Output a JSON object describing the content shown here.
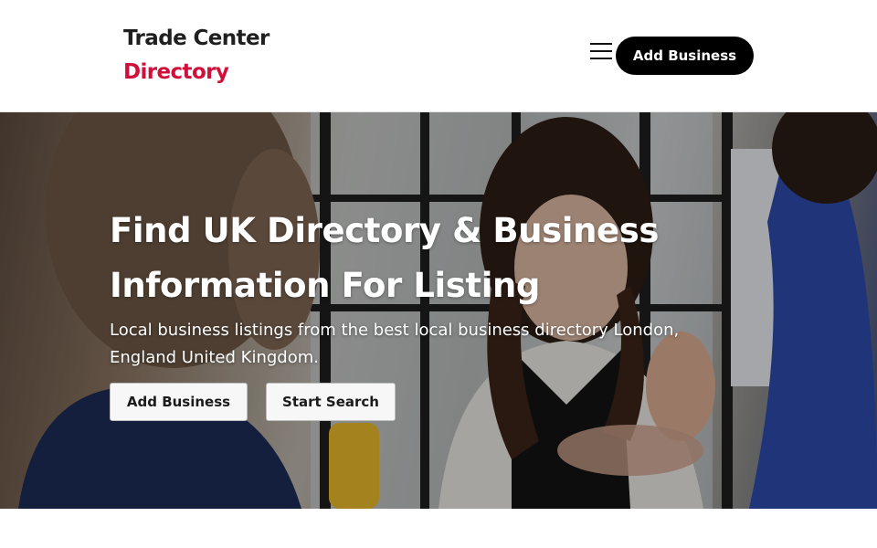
{
  "header": {
    "logo_line1": "Trade Center",
    "logo_line2": "Directory",
    "menu_icon": "hamburger-menu-icon",
    "cta_label": "Add Business"
  },
  "hero": {
    "title_line1": "Find UK Directory & Business",
    "title_line2": "Information For Listing",
    "subtitle": "Local business listings from the best local business directory London, England United Kingdom.",
    "buttons": [
      {
        "label": "Add Business"
      },
      {
        "label": "Start Search"
      }
    ]
  },
  "colors": {
    "brand_red": "#d0103a",
    "dark": "#1f1f1f",
    "cta_bg": "#000000"
  }
}
